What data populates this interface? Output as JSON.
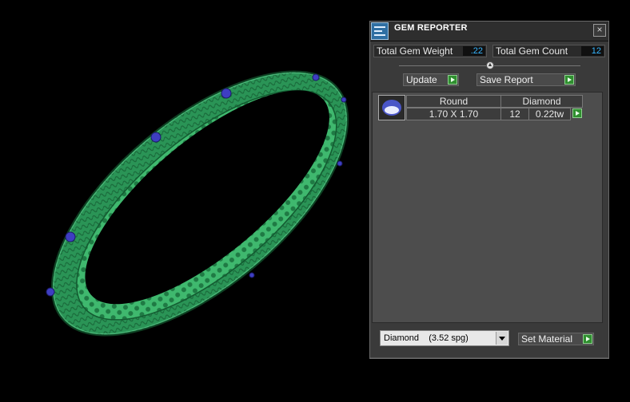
{
  "panel": {
    "title": "GEM REPORTER",
    "close_glyph": "×",
    "app_icon": "gem-reporter-icon"
  },
  "stats": {
    "total_weight_label": "Total Gem Weight",
    "total_weight_value": ".22",
    "total_count_label": "Total Gem Count",
    "total_count_value": "12"
  },
  "buttons": {
    "update": "Update",
    "save_report": "Save Report",
    "set_material": "Set Material"
  },
  "gem_table": {
    "headers": [
      "Round",
      "Diamond"
    ],
    "row": {
      "size": "1.70 X 1.70",
      "count": "12",
      "weight": "0.22tw"
    }
  },
  "material_select": {
    "selected": "Diamond    (3.52 spg)"
  },
  "colors": {
    "bangle": "#2e9a5a",
    "gem": "#3e3ec2",
    "value_text": "#36b6ff",
    "go_button": "#2f8f2f"
  }
}
